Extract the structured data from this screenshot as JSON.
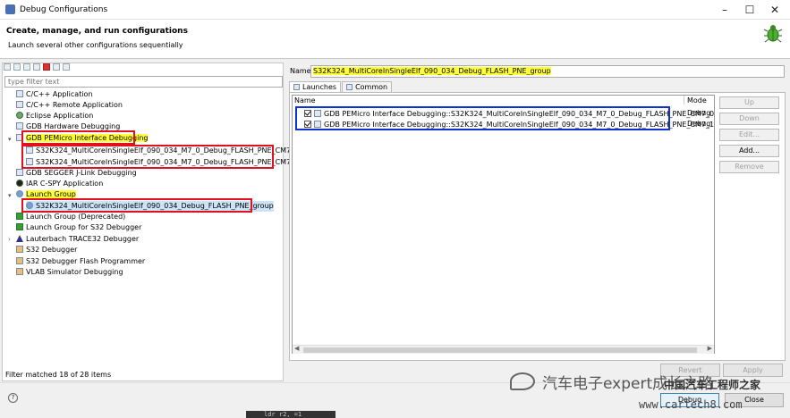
{
  "window": {
    "title": "Debug Configurations",
    "controls": [
      "–",
      "☐",
      "✕"
    ]
  },
  "header": {
    "title": "Create, manage, and run configurations",
    "subtitle": "Launch several other configurations sequentially"
  },
  "left": {
    "filter_placeholder": "type filter text",
    "tree": [
      {
        "label": "C/C++ Application"
      },
      {
        "label": "C/C++ Remote Application"
      },
      {
        "label": "Eclipse Application"
      },
      {
        "label": "GDB Hardware Debugging"
      },
      {
        "label": "GDB PEMicro Interface Debugging"
      },
      {
        "label": "S32K324_MultiCoreInSingleElf_090_034_M7_0_Debug_FLASH_PNE_CM7_0"
      },
      {
        "label": "S32K324_MultiCoreInSingleElf_090_034_M7_0_Debug_FLASH_PNE_CM7_1"
      },
      {
        "label": "GDB SEGGER J-Link Debugging"
      },
      {
        "label": "IAR C-SPY Application"
      },
      {
        "label": "Launch Group"
      },
      {
        "label": "S32K324_MultiCoreInSingleElf_090_034_Debug_FLASH_PNE_group"
      },
      {
        "label": "Launch Group (Deprecated)"
      },
      {
        "label": "Launch Group for S32 Debugger"
      },
      {
        "label": "Lauterbach TRACE32 Debugger"
      },
      {
        "label": "S32 Debugger"
      },
      {
        "label": "S32 Debugger Flash Programmer"
      },
      {
        "label": "VLAB Simulator Debugging"
      }
    ],
    "filter_status": "Filter matched 18 of 28 items"
  },
  "right": {
    "name_label": "Name:",
    "name_value": "S32K324_MultiCoreInSingleElf_090_034_Debug_FLASH_PNE_group",
    "tabs": [
      "Launches",
      "Common"
    ],
    "table": {
      "headers": [
        "Name",
        "Mode"
      ],
      "rows": [
        {
          "name": "GDB PEMicro Interface Debugging::S32K324_MultiCoreInSingleElf_090_034_M7_0_Debug_FLASH_PNE_CM7_0",
          "mode": "Debug"
        },
        {
          "name": "GDB PEMicro Interface Debugging::S32K324_MultiCoreInSingleElf_090_034_M7_0_Debug_FLASH_PNE_CM7_1",
          "mode": "Debug"
        }
      ]
    },
    "buttons": {
      "up": "Up",
      "down": "Down",
      "edit": "Edit...",
      "add": "Add...",
      "remove": "Remove"
    },
    "revert": "Revert",
    "apply": "Apply"
  },
  "footer": {
    "help": "?",
    "debug": "Debug",
    "close": "Close"
  },
  "console_fragment": "ldr  r2, =1",
  "watermark": {
    "text": "汽车电子expert成长之路",
    "site_cn": "中国汽车工程师之家",
    "url": "www.cartech8.com"
  },
  "colors": {
    "highlight": "#ffff33",
    "red_box": "#e01020",
    "blue_box": "#1030d0",
    "selection": "#cce4f7"
  }
}
